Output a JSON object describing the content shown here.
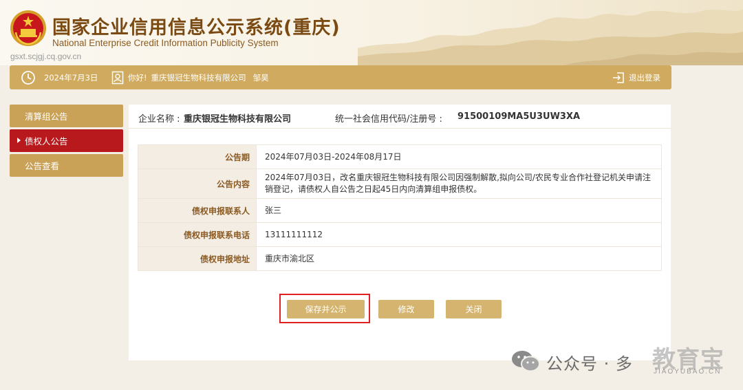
{
  "header": {
    "title_cn": "国家企业信用信息公示系统(重庆)",
    "title_en": "National Enterprise Credit Information Publicity System",
    "site_url": "gsxt.scjgj.cq.gov.cn"
  },
  "topbar": {
    "date": "2024年7月3日",
    "greeting": "你好!",
    "company": "重庆银冠生物科技有限公司",
    "user": "邹昊",
    "logout_label": "退出登录"
  },
  "sidebar": {
    "items": [
      {
        "label": "清算组公告",
        "active": false
      },
      {
        "label": "债权人公告",
        "active": true
      },
      {
        "label": "公告查看",
        "active": false
      }
    ]
  },
  "company_info": {
    "name_label": "企业名称 :",
    "name_value": "重庆银冠生物科技有限公司",
    "code_label": "统一社会信用代码/注册号 :",
    "code_value": "91500109MA5U3UW3XA"
  },
  "details": {
    "rows": [
      {
        "key": "公告期",
        "value": "2024年07月03日-2024年08月17日"
      },
      {
        "key": "公告内容",
        "value": "2024年07月03日，改名重庆银冠生物科技有限公司因强制解散,拟向公司/农民专业合作社登记机关申请注销登记，请债权人自公告之日起45日内向清算组申报债权。"
      },
      {
        "key": "债权申报联系人",
        "value": "张三"
      },
      {
        "key": "债权申报联系电话",
        "value": "13111111112"
      },
      {
        "key": "债权申报地址",
        "value": "重庆市渝北区"
      }
    ]
  },
  "actions": {
    "save_label": "保存并公示",
    "edit_label": "修改",
    "close_label": "关闭"
  },
  "watermark": {
    "text": "公众号 · 多",
    "logo": "教育宝",
    "sub": "JIAOYUBAO.CN"
  },
  "colors": {
    "gold": "#cfaa5f",
    "active_red": "#b8191d",
    "button_gold": "#d4b46e",
    "highlight_red": "#e02020"
  }
}
